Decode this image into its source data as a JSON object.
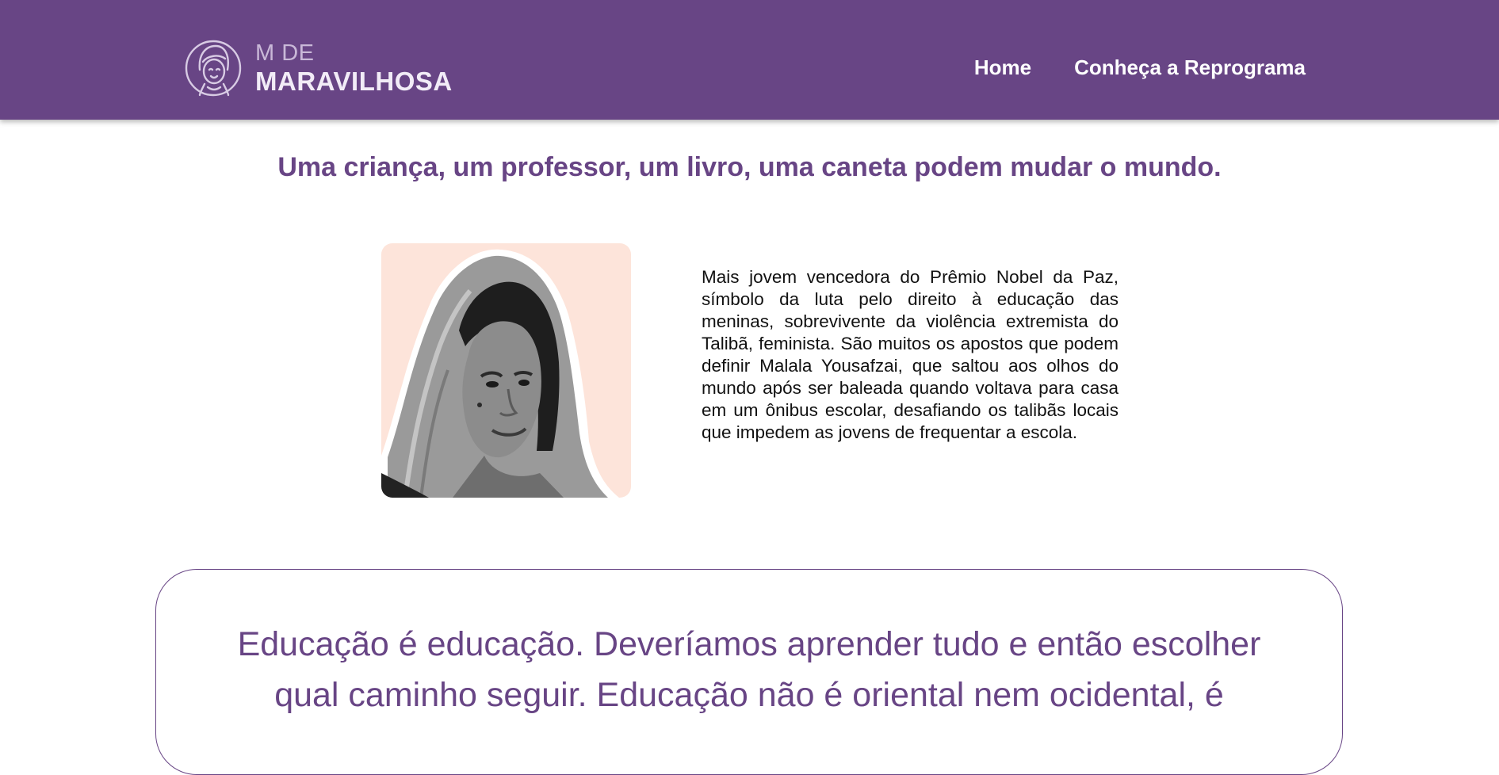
{
  "header": {
    "logo": {
      "line1": "M DE",
      "line2": "MARAVILHOSA",
      "icon": "woman-face-logo-icon"
    },
    "nav": [
      {
        "label": "Home"
      },
      {
        "label": "Conheça a Reprograma"
      }
    ]
  },
  "headline": "Uma criança, um professor, um livro, uma caneta podem mudar o mundo.",
  "profile": {
    "image": "malala-portrait-photo",
    "bio": "Mais jovem vencedora do Prêmio Nobel da Paz, símbolo da luta pelo direito à educação das meninas, sobrevivente da violência extremista do Talibã, feminista. São muitos os apostos que podem definir Malala Yousafzai, que saltou aos olhos do mundo após ser baleada quando voltava para casa em um ônibus escolar, desafiando os talibãs locais que impedem as jovens de frequentar a escola."
  },
  "quote": {
    "text": "Educação é educação. Deveríamos aprender tudo e então escolher qual caminho seguir. Educação não é oriental nem ocidental, é"
  },
  "colors": {
    "brand_purple": "#684585",
    "portrait_background": "#fde4da",
    "header_text": "#ffffff"
  }
}
